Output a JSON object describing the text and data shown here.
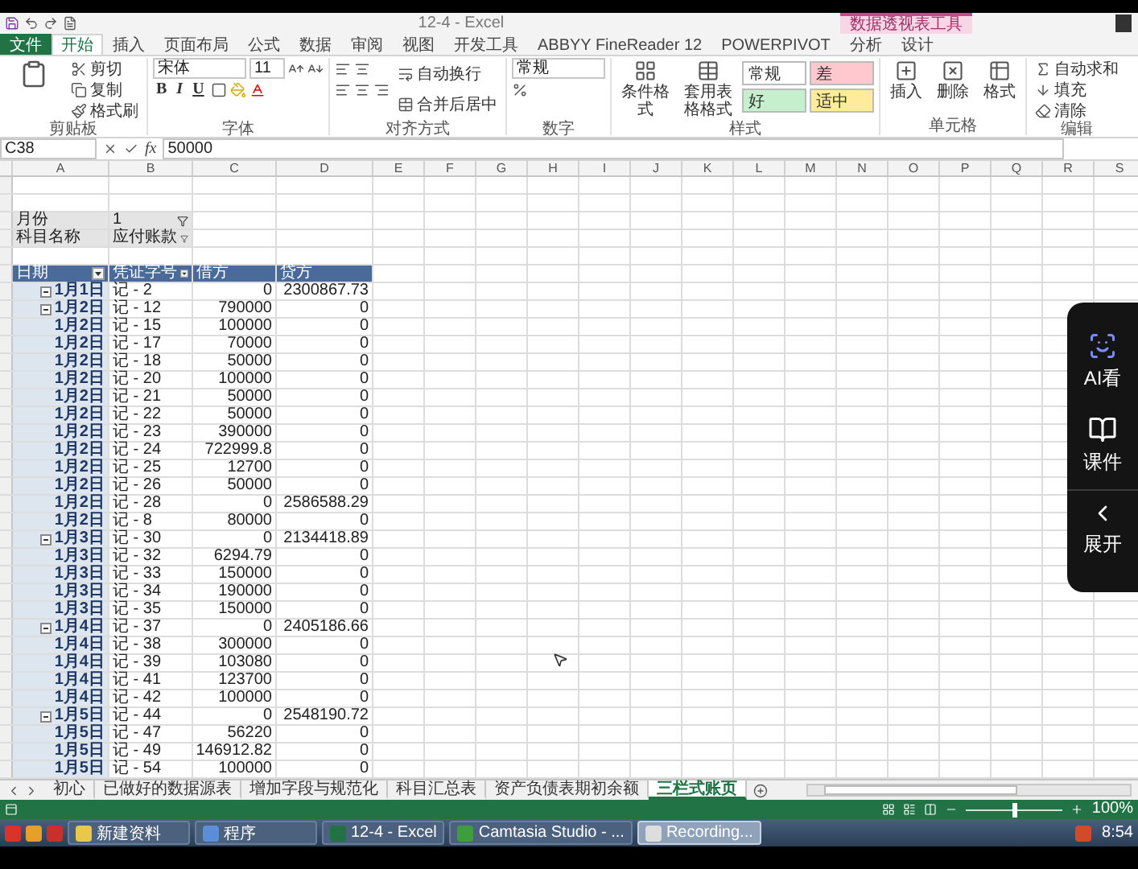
{
  "window": {
    "title": "12-4 - Excel",
    "context_tool": "数据透视表工具"
  },
  "ribbon_tabs": [
    {
      "label": "文件",
      "kind": "file",
      "selected": false
    },
    {
      "label": "开始",
      "kind": "tab",
      "selected": true
    },
    {
      "label": "插入",
      "kind": "tab",
      "selected": false
    },
    {
      "label": "页面布局",
      "kind": "tab",
      "selected": false
    },
    {
      "label": "公式",
      "kind": "tab",
      "selected": false
    },
    {
      "label": "数据",
      "kind": "tab",
      "selected": false
    },
    {
      "label": "审阅",
      "kind": "tab",
      "selected": false
    },
    {
      "label": "视图",
      "kind": "tab",
      "selected": false
    },
    {
      "label": "开发工具",
      "kind": "tab",
      "selected": false
    },
    {
      "label": "ABBYY FineReader 12",
      "kind": "tab",
      "selected": false
    },
    {
      "label": "POWERPIVOT",
      "kind": "tab",
      "selected": false
    },
    {
      "label": "分析",
      "kind": "context",
      "selected": false
    },
    {
      "label": "设计",
      "kind": "context",
      "selected": false
    }
  ],
  "ribbon": {
    "clipboard": {
      "label": "剪贴板",
      "commands": [
        "剪切",
        "复制",
        "格式刷"
      ]
    },
    "font": {
      "label": "字体",
      "font_name": "宋体",
      "font_size": "11",
      "styles": [
        "B",
        "I",
        "U"
      ]
    },
    "alignment": {
      "label": "对齐方式",
      "commands": [
        "自动换行",
        "合并后居中"
      ]
    },
    "number": {
      "label": "数字",
      "format": "常规"
    },
    "styles": {
      "label": "样式",
      "commands": [
        "条件格式",
        "套用表格格式"
      ],
      "cell_styles": [
        {
          "label": "常规",
          "color": "#ffffff"
        },
        {
          "label": "差",
          "color": "#ffc7ce"
        },
        {
          "label": "好",
          "color": "#c6efce"
        },
        {
          "label": "适中",
          "color": "#ffeb9c"
        }
      ]
    },
    "cells": {
      "label": "单元格",
      "commands": [
        "插入",
        "删除",
        "格式"
      ]
    },
    "editing": {
      "label": "编辑",
      "commands": [
        "自动求和",
        "填充",
        "清除"
      ]
    }
  },
  "formula_bar": {
    "name_box": "C38",
    "function_label": "fx",
    "formula": "50000"
  },
  "column_headers": [
    "A",
    "B",
    "C",
    "D",
    "E",
    "F",
    "G",
    "H",
    "I",
    "J",
    "K",
    "L",
    "M",
    "N",
    "O",
    "P",
    "Q",
    "R",
    "S"
  ],
  "pivot_filters": [
    {
      "label": "月份",
      "value": "1"
    },
    {
      "label": "科目名称",
      "value": "应付账款"
    }
  ],
  "pivot_table": {
    "columns": [
      {
        "label": "日期",
        "filter": true
      },
      {
        "label": "凭证字号",
        "filter": true
      },
      {
        "label": "借方",
        "filter": false
      },
      {
        "label": "贷方",
        "filter": false
      }
    ],
    "rows": [
      {
        "date": "1月1日",
        "voucher": "记 - 2",
        "debit": "0",
        "credit": "2300867.73",
        "collapsible": true
      },
      {
        "date": "1月2日",
        "voucher": "记 - 12",
        "debit": "790000",
        "credit": "0",
        "collapsible": true
      },
      {
        "date": "1月2日",
        "voucher": "记 - 15",
        "debit": "100000",
        "credit": "0",
        "collapsible": false
      },
      {
        "date": "1月2日",
        "voucher": "记 - 17",
        "debit": "70000",
        "credit": "0",
        "collapsible": false
      },
      {
        "date": "1月2日",
        "voucher": "记 - 18",
        "debit": "50000",
        "credit": "0",
        "collapsible": false
      },
      {
        "date": "1月2日",
        "voucher": "记 - 20",
        "debit": "100000",
        "credit": "0",
        "collapsible": false
      },
      {
        "date": "1月2日",
        "voucher": "记 - 21",
        "debit": "50000",
        "credit": "0",
        "collapsible": false
      },
      {
        "date": "1月2日",
        "voucher": "记 - 22",
        "debit": "50000",
        "credit": "0",
        "collapsible": false
      },
      {
        "date": "1月2日",
        "voucher": "记 - 23",
        "debit": "390000",
        "credit": "0",
        "collapsible": false
      },
      {
        "date": "1月2日",
        "voucher": "记 - 24",
        "debit": "722999.8",
        "credit": "0",
        "collapsible": false
      },
      {
        "date": "1月2日",
        "voucher": "记 - 25",
        "debit": "12700",
        "credit": "0",
        "collapsible": false
      },
      {
        "date": "1月2日",
        "voucher": "记 - 26",
        "debit": "50000",
        "credit": "0",
        "collapsible": false
      },
      {
        "date": "1月2日",
        "voucher": "记 - 28",
        "debit": "0",
        "credit": "2586588.29",
        "collapsible": false
      },
      {
        "date": "1月2日",
        "voucher": "记 - 8",
        "debit": "80000",
        "credit": "0",
        "collapsible": false
      },
      {
        "date": "1月3日",
        "voucher": "记 - 30",
        "debit": "0",
        "credit": "2134418.89",
        "collapsible": true
      },
      {
        "date": "1月3日",
        "voucher": "记 - 32",
        "debit": "6294.79",
        "credit": "0",
        "collapsible": false
      },
      {
        "date": "1月3日",
        "voucher": "记 - 33",
        "debit": "150000",
        "credit": "0",
        "collapsible": false
      },
      {
        "date": "1月3日",
        "voucher": "记 - 34",
        "debit": "190000",
        "credit": "0",
        "collapsible": false
      },
      {
        "date": "1月3日",
        "voucher": "记 - 35",
        "debit": "150000",
        "credit": "0",
        "collapsible": false
      },
      {
        "date": "1月4日",
        "voucher": "记 - 37",
        "debit": "0",
        "credit": "2405186.66",
        "collapsible": true
      },
      {
        "date": "1月4日",
        "voucher": "记 - 38",
        "debit": "300000",
        "credit": "0",
        "collapsible": false
      },
      {
        "date": "1月4日",
        "voucher": "记 - 39",
        "debit": "103080",
        "credit": "0",
        "collapsible": false
      },
      {
        "date": "1月4日",
        "voucher": "记 - 41",
        "debit": "123700",
        "credit": "0",
        "collapsible": false
      },
      {
        "date": "1月4日",
        "voucher": "记 - 42",
        "debit": "100000",
        "credit": "0",
        "collapsible": false
      },
      {
        "date": "1月5日",
        "voucher": "记 - 44",
        "debit": "0",
        "credit": "2548190.72",
        "collapsible": true
      },
      {
        "date": "1月5日",
        "voucher": "记 - 47",
        "debit": "56220",
        "credit": "0",
        "collapsible": false
      },
      {
        "date": "1月5日",
        "voucher": "记 - 49",
        "debit": "146912.82",
        "credit": "0",
        "collapsible": false
      },
      {
        "date": "1月5日",
        "voucher": "记 - 54",
        "debit": "100000",
        "credit": "0",
        "collapsible": false
      }
    ]
  },
  "sheet_tabs": [
    {
      "label": "初心",
      "selected": false
    },
    {
      "label": "已做好的数据源表",
      "selected": false
    },
    {
      "label": "增加字段与规范化",
      "selected": false
    },
    {
      "label": "科目汇总表",
      "selected": false
    },
    {
      "label": "资产负债表期初余额",
      "selected": false
    },
    {
      "label": "三栏式账页",
      "selected": true
    }
  ],
  "status_bar": {
    "zoom": {
      "level": 0.5,
      "label": "100%"
    }
  },
  "taskbar": {
    "buttons": [
      {
        "label": "新建资料",
        "selected": false
      },
      {
        "label": "程序",
        "selected": false
      },
      {
        "label": "12-4 - Excel",
        "selected": false
      },
      {
        "label": "Camtasia Studio - ...",
        "selected": false
      },
      {
        "label": "Recording...",
        "selected": true
      }
    ],
    "clock": "8:54"
  },
  "side_panel": {
    "items": [
      {
        "label": "AI看",
        "kind": "ai"
      },
      {
        "label": "课件",
        "kind": "courseware"
      },
      {
        "label": "展开",
        "kind": "expand"
      }
    ]
  }
}
